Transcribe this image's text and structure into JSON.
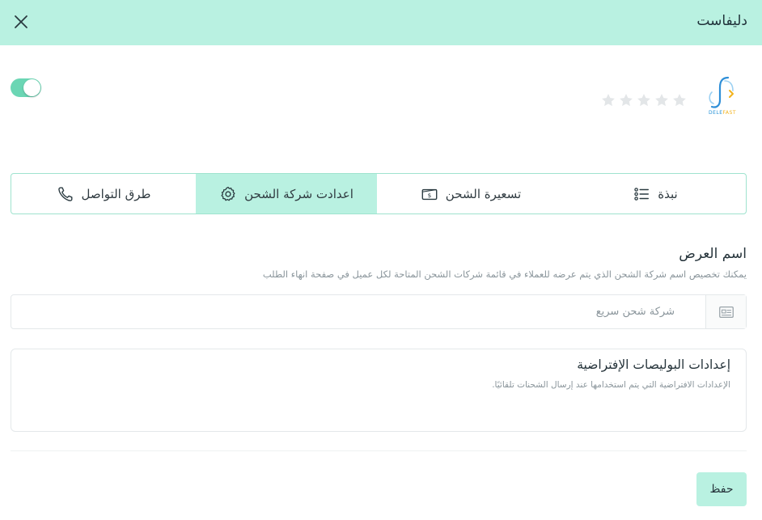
{
  "header": {
    "title": "دليفاست",
    "close_icon": "close-icon"
  },
  "provider": {
    "logo_text_dele": "DELE",
    "logo_text_fast": "FAST",
    "enabled": true,
    "rating": 0,
    "rating_max": 5
  },
  "tabs": [
    {
      "label": "نبذة",
      "icon": "list-icon",
      "active": false
    },
    {
      "label": "تسعيرة الشحن",
      "icon": "money-icon",
      "active": false
    },
    {
      "label": "اعدادت شركة الشحن",
      "icon": "gear-icon",
      "active": true
    },
    {
      "label": "طرق التواصل",
      "icon": "phone-icon",
      "active": false
    }
  ],
  "display_name": {
    "title": "اسم العرض",
    "description": "يمكنك تخصيص اسم شركة الشحن الذي يتم عرضه للعملاء في قائمة شركات الشحن المتاحة لكل عميل في صفحة انهاء الطلب",
    "placeholder": "شركة شحن سريع",
    "value": ""
  },
  "policy_settings": {
    "title": "إعدادات البوليصات الإفتراضية",
    "description": "الإعدادات الافتراضية التي يتم استخدامها عند إرسال الشحنات تلقائيًا."
  },
  "actions": {
    "save_label": "حفظ"
  },
  "colors": {
    "accent": "#b9f1e1",
    "toggle": "#6bd6b4",
    "border_accent": "#9fe3cf",
    "star": "#e3e6e8"
  }
}
